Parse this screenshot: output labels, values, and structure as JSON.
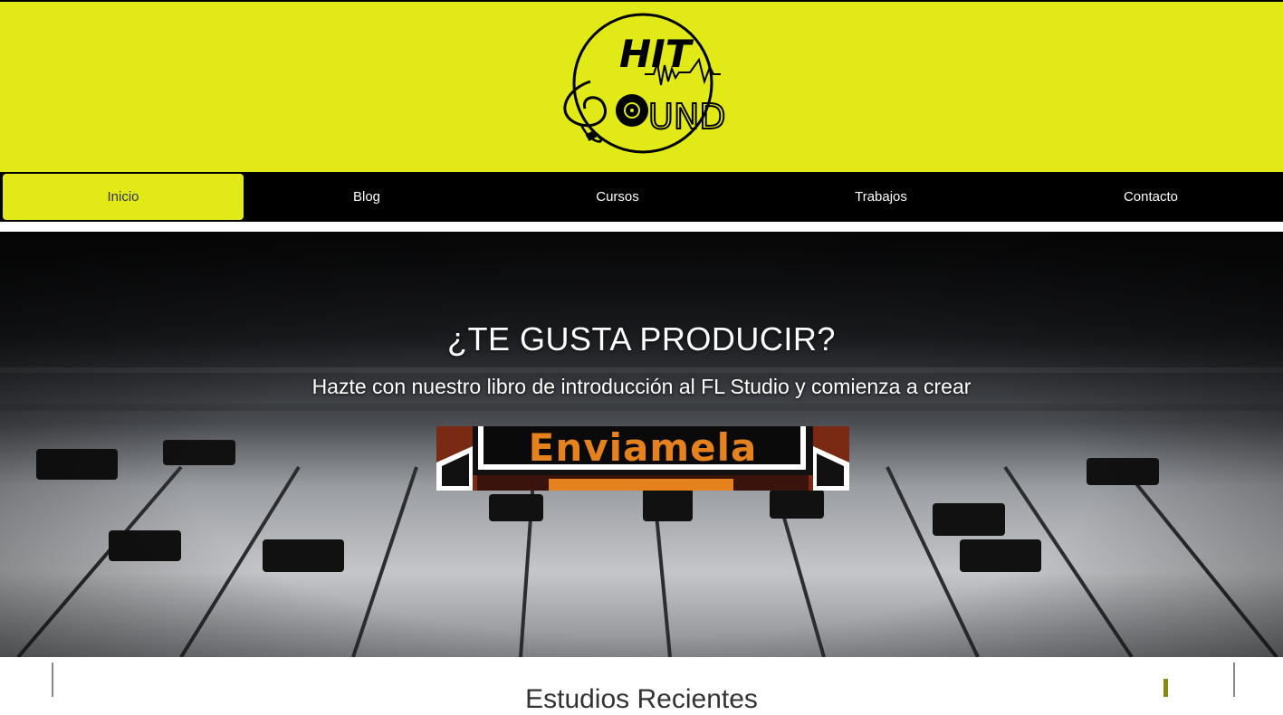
{
  "header": {
    "logo_text_top": "HIT",
    "logo_text_bottom": "SOUND"
  },
  "nav": {
    "items": [
      {
        "label": "Inicio",
        "active": true
      },
      {
        "label": "Blog",
        "active": false
      },
      {
        "label": "Cursos",
        "active": false
      },
      {
        "label": "Trabajos",
        "active": false
      },
      {
        "label": "Contacto",
        "active": false
      }
    ]
  },
  "hero": {
    "title": "¿TE GUSTA PRODUCIR?",
    "subtitle": "Hazte con nuestro libro de introducción al FL Studio y comienza a crear",
    "cta_label": "Enviamela"
  },
  "section": {
    "title": "Estudios Recientes"
  },
  "colors": {
    "brand_yellow": "#e1e916",
    "nav_bg": "#000000",
    "cta_text": "#e6821e"
  }
}
